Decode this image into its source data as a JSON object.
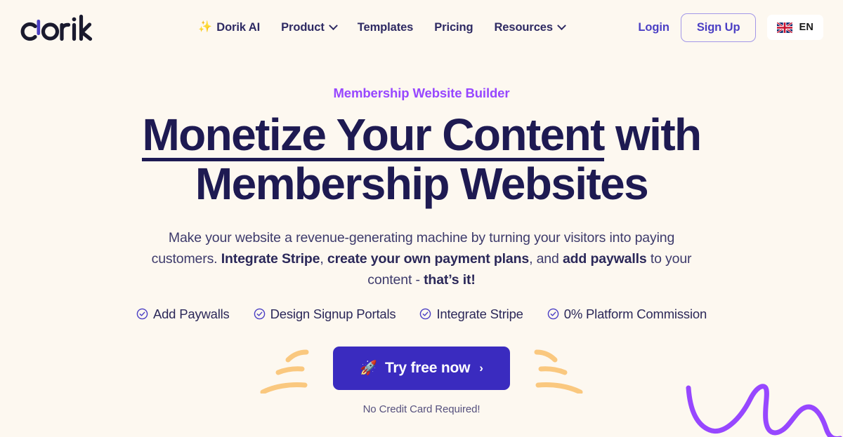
{
  "theme": {
    "background": "#fdf8f0",
    "navy": "#1e1a52",
    "indigo": "#3a2bbf",
    "purple_accent": "#9747ff",
    "orange_stroke": "#fac87f",
    "link_purple": "#4b3fc4"
  },
  "header": {
    "logo_text": "dorik",
    "logo_icon": "dorik-wordmark-logo",
    "nav": [
      {
        "label": "Dorik AI",
        "icon": "sparkles-icon",
        "has_dropdown": false
      },
      {
        "label": "Product",
        "icon": null,
        "has_dropdown": true
      },
      {
        "label": "Templates",
        "icon": null,
        "has_dropdown": false
      },
      {
        "label": "Pricing",
        "icon": null,
        "has_dropdown": false
      },
      {
        "label": "Resources",
        "icon": null,
        "has_dropdown": true
      }
    ],
    "login_label": "Login",
    "signup_label": "Sign Up",
    "language": {
      "code": "EN",
      "flag_icon": "uk-flag-icon"
    }
  },
  "hero": {
    "eyebrow": "Membership Website Builder",
    "headline_line1_underlined": "Monetize Your Content",
    "headline_line1_rest": " with",
    "headline_line2": "Membership Websites",
    "subtitle": {
      "part1": "Make your website a revenue-generating machine by turning your visitors into paying customers. ",
      "bold1": "Integrate Stripe",
      "part2": ", ",
      "bold2": "create your own payment plans",
      "part3": ", and ",
      "bold3": "add paywalls",
      "part4": " to your content - ",
      "bold4": "that’s it!"
    },
    "features": [
      {
        "label": "Add Paywalls",
        "icon": "check-circle-icon"
      },
      {
        "label": "Design Signup Portals",
        "icon": "check-circle-icon"
      },
      {
        "label": "Integrate Stripe",
        "icon": "check-circle-icon"
      },
      {
        "label": "0% Platform Commission",
        "icon": "check-circle-icon"
      }
    ],
    "cta": {
      "icon": "rocket-icon",
      "label": "Try free now",
      "arrow": "›"
    },
    "cta_note": "No Credit Card Required!"
  },
  "decorations": {
    "cta_strokes_icon": "orange-motion-lines",
    "corner_squiggle_icon": "purple-squiggle-icon"
  }
}
